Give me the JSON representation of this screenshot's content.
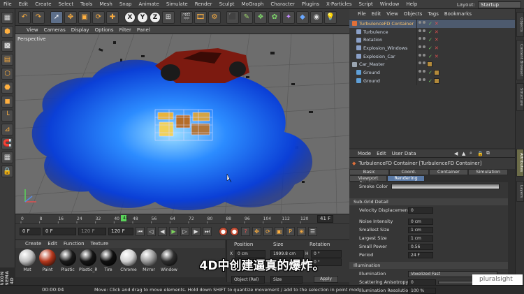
{
  "menubar": {
    "items": [
      "File",
      "Edit",
      "Create",
      "Select",
      "Tools",
      "Mesh",
      "Snap",
      "Animate",
      "Simulate",
      "Render",
      "Sculpt",
      "MoGraph",
      "Character",
      "Plugins",
      "X-Particles",
      "Script",
      "Window",
      "Help"
    ],
    "layout_label": "Layout:",
    "layout_value": "Startup"
  },
  "toolbar": {
    "axes": [
      "X",
      "Y",
      "Z"
    ]
  },
  "viewport": {
    "menu": [
      "View",
      "Cameras",
      "Display",
      "Options",
      "Filter",
      "Panel"
    ],
    "label": "Perspective"
  },
  "timeline": {
    "ticks": [
      "0",
      "8",
      "16",
      "24",
      "32",
      "40",
      "48",
      "56",
      "64",
      "72",
      "80",
      "88",
      "96",
      "104",
      "112",
      "120"
    ],
    "current": "41",
    "end_field": "41 F"
  },
  "playbar": {
    "start": "0 F",
    "current": "0 F",
    "min": "120 F",
    "max": "120 F"
  },
  "materials": {
    "menu": [
      "Create",
      "Edit",
      "Function",
      "Texture"
    ],
    "items": [
      {
        "name": "Mat",
        "color": "#bfbfbf"
      },
      {
        "name": "Paint",
        "color": "#b6381d"
      },
      {
        "name": "Plastic",
        "color": "#1a1a1a"
      },
      {
        "name": "Plastic_R",
        "color": "#151515"
      },
      {
        "name": "Tire",
        "color": "#101010"
      },
      {
        "name": "Chrome",
        "color": "#d0d0d0"
      },
      {
        "name": "Mirror",
        "color": "#9a9a9a"
      },
      {
        "name": "Window",
        "color": "#2e2e2e"
      }
    ]
  },
  "brand_side": "MAXON CINEMA 4D",
  "coords": {
    "headers": [
      "Position",
      "Size",
      "Rotation"
    ],
    "x_pos": "0 cm",
    "x_size": "1999.8 cm",
    "h_rot": "0 °",
    "y_pos": "0 cm",
    "y_size": "0 cm",
    "p_rot": "0 °",
    "mode1": "Object (Rel)",
    "mode2": "Size",
    "apply": "Apply"
  },
  "status": {
    "time": "00:00:04",
    "message": "Move: Click and drag to move elements. Hold down SHIFT to quantize movement / add to the selection in point mod"
  },
  "objects": {
    "menu": [
      "File",
      "Edit",
      "View",
      "Objects",
      "Tags",
      "Bookmarks"
    ],
    "rows": [
      {
        "name": "TurbulenceFD Container",
        "color": "#e0703a",
        "selected": true
      },
      {
        "name": "Turbulence",
        "color": "#8aa0c8",
        "selected": false
      },
      {
        "name": "Rotation",
        "color": "#8aa0c8",
        "selected": false
      },
      {
        "name": "Explosion_Windows",
        "color": "#8aa0c8",
        "selected": false
      },
      {
        "name": "Explosion_Car",
        "color": "#8aa0c8",
        "selected": false
      },
      {
        "name": "Car_Master",
        "color": "#9aa4b0",
        "selected": false
      },
      {
        "name": "Ground",
        "color": "#5fa0d8",
        "selected": false
      },
      {
        "name": "Ground",
        "color": "#5fa0d8",
        "selected": false
      }
    ]
  },
  "edge_tabs": [
    "Objects",
    "Content Browser",
    "Structure",
    "Attributes",
    "Layers"
  ],
  "attributes": {
    "menu": [
      "Mode",
      "Edit",
      "User Data"
    ],
    "title": "TurbulenceFD Container [TurbulenceFD Container]",
    "tabs_row1": [
      "Basic",
      "Coord.",
      "Container",
      "Simulation"
    ],
    "tabs_row2": [
      "Viewport Preview",
      "Rendering"
    ],
    "smoke_color_label": "Smoke Color",
    "subgrid_title": "Sub-Grid Detail",
    "rows": [
      {
        "label": "Velocity Displacement",
        "value": "0"
      },
      {
        "label": "Noise Intensity",
        "value": "0 cm"
      },
      {
        "label": "Smallest Size",
        "value": "1 cm"
      },
      {
        "label": "Largest Size",
        "value": "1 cm"
      },
      {
        "label": "Small Power",
        "value": "0.56"
      },
      {
        "label": "Period",
        "value": "24 F"
      }
    ],
    "illumination_title": "Illumination",
    "illumination_label": "Illumination",
    "illumination_value": "Voxelized Fast",
    "scattering_label": "Scattering Anisotropy",
    "scattering_value": "0",
    "illum_res_label": "Illumination Resolution",
    "illum_res_value": "100 %"
  },
  "subtitle": "4D中创建逼真的爆炸。",
  "brand": "pluralsight"
}
